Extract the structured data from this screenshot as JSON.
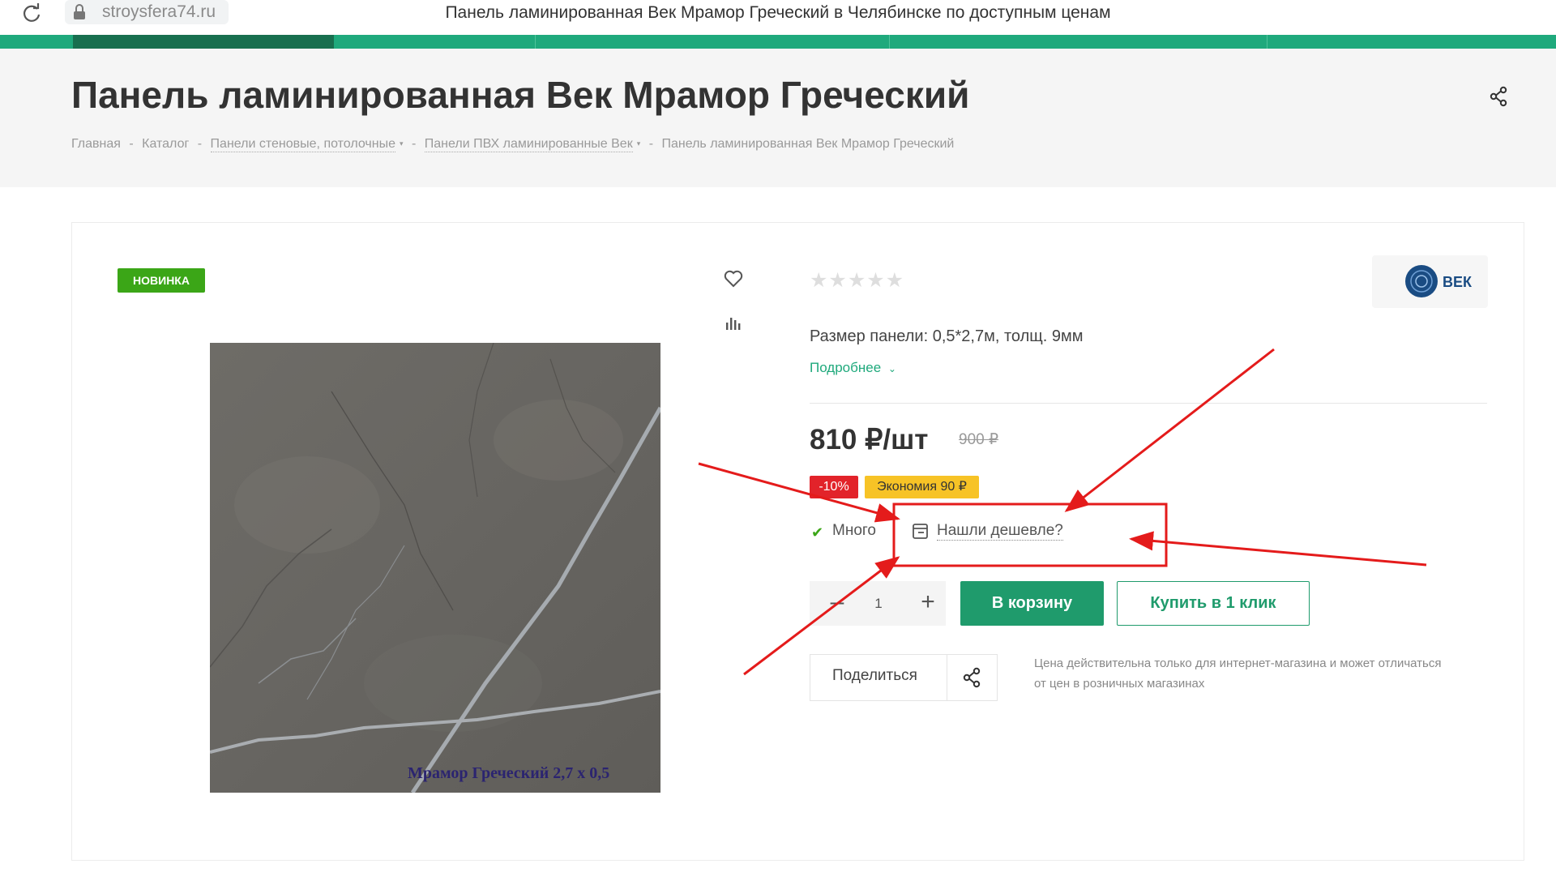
{
  "browser": {
    "url": "stroysfera74.ru",
    "tab_title": "Панель ламинированная Век Мрамор Греческий в Челябинске по доступным ценам"
  },
  "header": {
    "title": "Панель ламинированная Век Мрамор Греческий",
    "breadcrumb": {
      "home": "Главная",
      "catalog": "Каталог",
      "category": "Панели стеновые, потолочные",
      "subcategory": "Панели ПВХ ламинированные Век",
      "current": "Панель ламинированная Век Мрамор Греческий",
      "separator": "-"
    }
  },
  "product": {
    "badge_new": "НОВИНКА",
    "rating": 0,
    "rating_max": 5,
    "brand": "ВЕК",
    "image_caption": "Мрамор Греческий 2,7 х 0,5",
    "size_text": "Размер панели: 0,5*2,7м, толщ. 9мм",
    "more_link": "Подробнее",
    "price": "810 ₽/шт",
    "old_price": "900 ₽",
    "discount": "-10%",
    "economy": "Экономия 90 ₽",
    "stock": "Много",
    "cheaper_link": "Нашли дешевле?",
    "quantity": "1",
    "cart_button": "В корзину",
    "oneclick_button": "Купить в 1 клик",
    "share_label": "Поделиться",
    "price_note": "Цена действительна только для интернет-магазина и может отличаться от цен в розничных магазинах"
  },
  "icons": {
    "reload": "reload-icon",
    "lock": "lock-icon",
    "share": "share-icon",
    "favorite": "heart-icon",
    "compare": "compare-icon",
    "check": "check-icon",
    "calculator": "cheaper-icon"
  },
  "colors": {
    "accent": "#1fa97c",
    "badge_new": "#3ba617",
    "discount": "#e2232a",
    "economy": "#f7c326",
    "annotation": "#e41b1b"
  }
}
